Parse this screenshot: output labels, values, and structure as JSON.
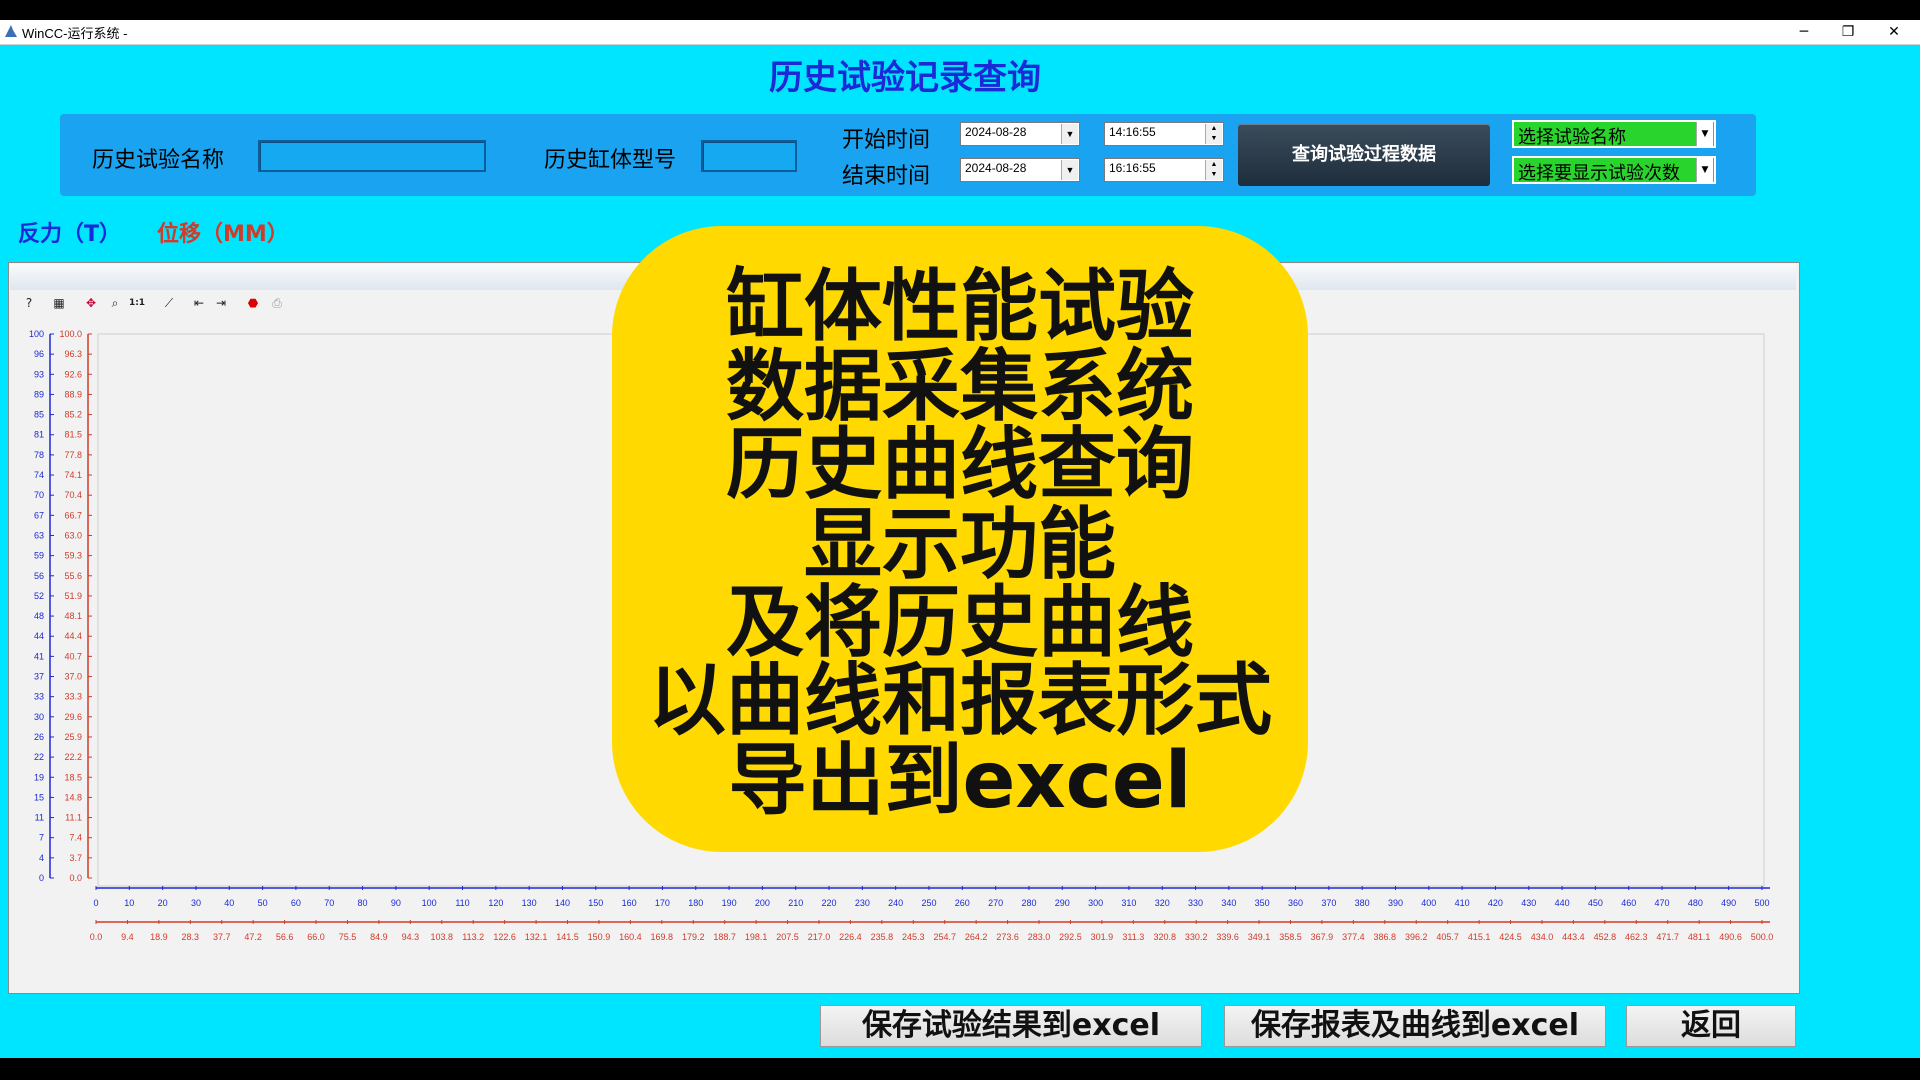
{
  "window": {
    "title": "WinCC-运行系统 -",
    "minimize": "─",
    "restore": "❐",
    "close": "✕"
  },
  "page_title": "历史试验记录查询",
  "query": {
    "test_name_label": "历史试验名称",
    "test_name_value": "",
    "cylinder_model_label": "历史缸体型号",
    "cylinder_model_value": "",
    "start_label": "开始时间",
    "end_label": "结束时间",
    "start_date": "2024-08-28",
    "start_time": "14:16:55",
    "end_date": "2024-08-28",
    "end_time": "16:16:55",
    "query_button": "查询试验过程数据",
    "select_test_name": "选择试验名称",
    "select_test_count": "选择要显示试验次数"
  },
  "legend": {
    "force": "反力（T）",
    "displacement": "位移（MM）"
  },
  "colors": {
    "background": "#00e5ff",
    "panel": "#1aa3f0",
    "title": "#1a2ad6",
    "force_axis": "#1a2ad6",
    "disp_axis": "#d13b2a",
    "combo": "#29d42c",
    "overlay": "#ffd900"
  },
  "toolbar": {
    "icons": [
      "help-icon",
      "table-icon",
      "move-icon",
      "zoom-icon",
      "ratio-icon",
      "curve-icon",
      "first-icon",
      "last-icon",
      "stop-icon",
      "print-icon"
    ],
    "ratio_label": "1:1"
  },
  "chart_data": {
    "type": "line",
    "series": [],
    "y_left_ticks": [
      "100",
      "96",
      "93",
      "89",
      "85",
      "81",
      "78",
      "74",
      "70",
      "67",
      "63",
      "59",
      "56",
      "52",
      "48",
      "44",
      "41",
      "37",
      "33",
      "30",
      "26",
      "22",
      "19",
      "15",
      "11",
      "7",
      "4",
      "0"
    ],
    "y_right_ticks": [
      "100.0",
      "96.3",
      "92.6",
      "88.9",
      "85.2",
      "81.5",
      "77.8",
      "74.1",
      "70.4",
      "66.7",
      "63.0",
      "59.3",
      "55.6",
      "51.9",
      "48.1",
      "44.4",
      "40.7",
      "37.0",
      "33.3",
      "29.6",
      "25.9",
      "22.2",
      "18.5",
      "14.8",
      "11.1",
      "7.4",
      "3.7",
      "0.0"
    ],
    "x_top_ticks": [
      "0",
      "10",
      "20",
      "30",
      "40",
      "50",
      "60",
      "70",
      "80",
      "90",
      "100",
      "110",
      "120",
      "130",
      "140",
      "150",
      "160",
      "170",
      "180",
      "190",
      "200",
      "210",
      "220",
      "230",
      "240",
      "250",
      "260",
      "270",
      "280",
      "290",
      "300",
      "310",
      "320",
      "330",
      "340",
      "350",
      "360",
      "370",
      "380",
      "390",
      "400",
      "410",
      "420",
      "430",
      "440",
      "450",
      "460",
      "470",
      "480",
      "490",
      "500"
    ],
    "x_bottom_ticks": [
      "0.0",
      "9.4",
      "18.9",
      "28.3",
      "37.7",
      "47.2",
      "56.6",
      "66.0",
      "75.5",
      "84.9",
      "94.3",
      "103.8",
      "113.2",
      "122.6",
      "132.1",
      "141.5",
      "150.9",
      "160.4",
      "169.8",
      "179.2",
      "188.7",
      "198.1",
      "207.5",
      "217.0",
      "226.4",
      "235.8",
      "245.3",
      "254.7",
      "264.2",
      "273.6",
      "283.0",
      "292.5",
      "301.9",
      "311.3",
      "320.8",
      "330.2",
      "339.6",
      "349.1",
      "358.5",
      "367.9",
      "377.4",
      "386.8",
      "396.2",
      "405.7",
      "415.1",
      "424.5",
      "434.0",
      "443.4",
      "452.8",
      "462.3",
      "471.7",
      "481.1",
      "490.6",
      "500.0"
    ],
    "ylim_force": [
      0,
      100
    ],
    "ylim_disp": [
      0,
      100
    ],
    "xlim_top": [
      0,
      500
    ],
    "xlim_bottom": [
      0,
      500
    ]
  },
  "overlay": {
    "lines": [
      "缸体性能试验",
      "数据采集系统",
      "历史曲线查询",
      "显示功能",
      "及将历史曲线",
      "以曲线和报表形式",
      "导出到excel"
    ]
  },
  "buttons": {
    "save_result": "保存试验结果到excel",
    "save_report": "保存报表及曲线到excel",
    "back": "返回"
  }
}
